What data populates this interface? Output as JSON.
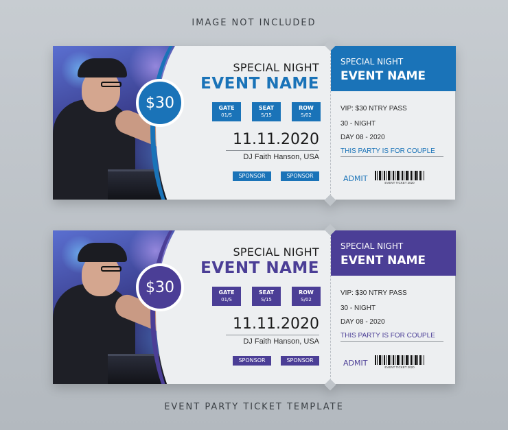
{
  "captions": {
    "top": "IMAGE NOT INCLUDED",
    "bottom": "EVENT PARTY TICKET TEMPLATE"
  },
  "colors": {
    "ticket1_accent": "#1a73b8",
    "ticket2_accent": "#4b3e96",
    "background": "#c7ccd1",
    "ticket_body": "#edeff1"
  },
  "tickets": [
    {
      "price": "$30",
      "special": "SPECIAL NIGHT",
      "event_name": "EVENT NAME",
      "gate_label": "GATE",
      "gate_value": "01/S",
      "seat_label": "SEAT",
      "seat_value": "S/15",
      "row_label": "ROW",
      "row_value": "S/02",
      "date": "11.11.2020",
      "dj": "DJ Faith Hanson, USA",
      "sponsor1": "SPONSOR",
      "sponsor2": "SPONSOR",
      "stub": {
        "special": "SPECIAL NIGHT",
        "event_name": "EVENT NAME",
        "line1": "VIP: $30 NTRY PASS",
        "line2": "30 - NIGHT",
        "line3": "DAY 08 - 2020",
        "couple": "THIS PARTY IS FOR COUPLE",
        "admit": "ADMIT",
        "barcode_text": "EVENT TICKET 2020"
      }
    },
    {
      "price": "$30",
      "special": "SPECIAL NIGHT",
      "event_name": "EVENT NAME",
      "gate_label": "GATE",
      "gate_value": "01/S",
      "seat_label": "SEAT",
      "seat_value": "S/15",
      "row_label": "ROW",
      "row_value": "S/02",
      "date": "11.11.2020",
      "dj": "DJ Faith Hanson, USA",
      "sponsor1": "SPONSOR",
      "sponsor2": "SPONSOR",
      "stub": {
        "special": "SPECIAL NIGHT",
        "event_name": "EVENT NAME",
        "line1": "VIP: $30 NTRY PASS",
        "line2": "30 - NIGHT",
        "line3": "DAY 08 - 2020",
        "couple": "THIS PARTY IS FOR COUPLE",
        "admit": "ADMIT",
        "barcode_text": "EVENT TICKET 2020"
      }
    }
  ]
}
